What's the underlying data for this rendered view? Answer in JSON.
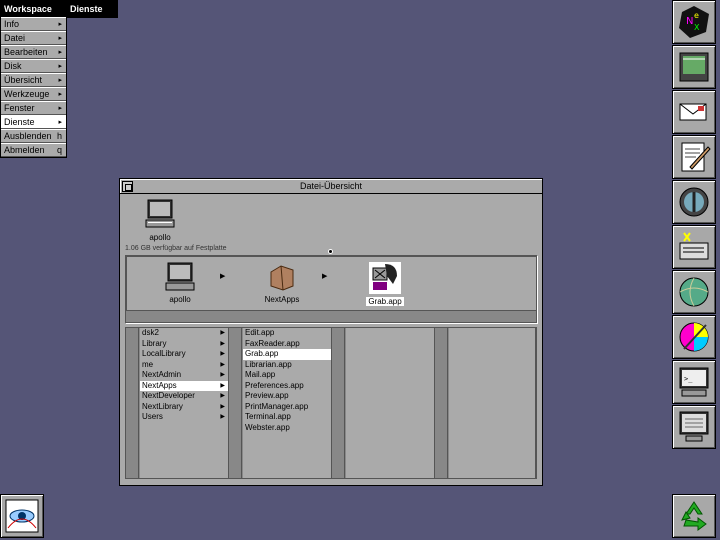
{
  "workspace_menu": {
    "title": "Workspace",
    "items": [
      {
        "label": "Info",
        "submenu": true
      },
      {
        "label": "Datei",
        "submenu": true
      },
      {
        "label": "Bearbeiten",
        "submenu": true
      },
      {
        "label": "Disk",
        "submenu": true
      },
      {
        "label": "Übersicht",
        "submenu": true
      },
      {
        "label": "Werkzeuge",
        "submenu": true
      },
      {
        "label": "Fenster",
        "submenu": true
      },
      {
        "label": "Dienste",
        "submenu": true,
        "selected": true
      },
      {
        "label": "Ausblenden",
        "key": "h"
      },
      {
        "label": "Abmelden",
        "key": "q"
      }
    ]
  },
  "services_menu": {
    "title": "Dienste"
  },
  "window": {
    "title": "Datei-Übersicht",
    "shelf_icon_label": "apollo",
    "disk_info": "1.06 GB verfügbar auf Festplatte",
    "path": [
      {
        "label": "apollo"
      },
      {
        "label": "NextApps"
      },
      {
        "label": "Grab.app"
      }
    ],
    "columns": [
      {
        "items": [
          {
            "label": "dsk2",
            "dir": true
          },
          {
            "label": "Library",
            "dir": true
          },
          {
            "label": "LocalLibrary",
            "dir": true
          },
          {
            "label": "me",
            "dir": true
          },
          {
            "label": "NextAdmin",
            "dir": true
          },
          {
            "label": "NextApps",
            "dir": true,
            "selected": true
          },
          {
            "label": "NextDeveloper",
            "dir": true
          },
          {
            "label": "NextLibrary",
            "dir": true
          },
          {
            "label": "Users",
            "dir": true
          }
        ]
      },
      {
        "items": [
          {
            "label": "Edit.app"
          },
          {
            "label": "FaxReader.app"
          },
          {
            "label": "Grab.app",
            "selected": true
          },
          {
            "label": "Librarian.app"
          },
          {
            "label": "Mail.app"
          },
          {
            "label": "Preferences.app"
          },
          {
            "label": "Preview.app"
          },
          {
            "label": "PrintManager.app"
          },
          {
            "label": "Terminal.app"
          },
          {
            "label": "Webster.app"
          }
        ]
      },
      {
        "items": []
      },
      {
        "items": []
      }
    ]
  },
  "dock": {
    "icons": [
      "nextstep-cube-icon",
      "preferences-icon",
      "mail-icon",
      "edit-icon",
      "librarian-icon",
      "digital-librarian-icon",
      "globe-icon",
      "color-wheel-icon",
      "terminal-icon",
      "monitor-icon"
    ],
    "bottom_right": "recycler-icon",
    "bottom_left": "eye-icon"
  }
}
